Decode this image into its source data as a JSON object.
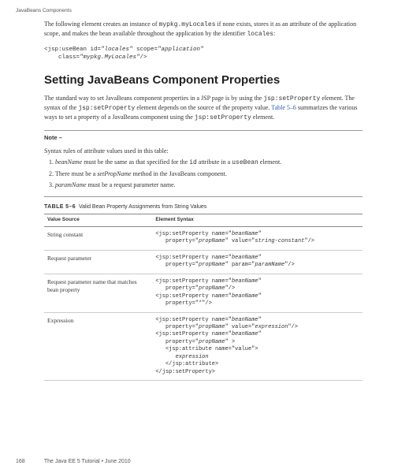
{
  "running_head": "JavaBeans Components",
  "intro_html": "The following element creates an instance of <span class=\"mono\">mypkg.myLocales</span> if none exists, stores it as an attribute of the application scope, and makes the bean available throughout the application by the identifier <span class=\"mono\">locales</span>:",
  "code_block": "<jsp:useBean id=<span class=\"it\">\"locales\"</span> scope=<span class=\"it\">\"application\"</span>\n    class=<span class=\"it\">\"mypkg.MyLocales\"</span>/>",
  "heading": "Setting JavaBeans Component Properties",
  "body_html": "The standard way to set JavaBeans component properties in a JSP page is by using the <span class=\"mono\">jsp:setProperty</span> element. The syntax of the <span class=\"mono\">jsp:setProperty</span> element depends on the source of the property value. <span class=\"link\">Table 5–6</span> summarizes the various ways to set a property of a JavaBeans component using the <span class=\"mono\">jsp:setProperty</span> element.",
  "note_label": "Note –",
  "syntax_rules_lead": "Syntax rules of attribute values used in this table:",
  "rules": [
    "<span class=\"italic\">beanName</span> must be the same as that specified for the <span class=\"mono\">id</span> attribute in a <span class=\"mono\">useBean</span> element.",
    "There must be a <span class=\"italic\">setPropName</span> method in the JavaBeans component.",
    "<span class=\"italic\">paramName</span> must be a request parameter name."
  ],
  "table": {
    "tag": "TABLE 5–6",
    "title": "Valid Bean Property Assignments from String Values",
    "headers": [
      "Value Source",
      "Element Syntax"
    ],
    "rows": [
      {
        "source": "String constant",
        "syntax": "<jsp:setProperty name=\"<span class=\"it\">beanName</span>\"\n   property=\"<span class=\"it\">propName</span>\" value=\"<span class=\"it\">string-constant</span>\"/>"
      },
      {
        "source": "Request parameter",
        "syntax": "<jsp:setProperty name=\"<span class=\"it\">beanName</span>\"\n   property=\"<span class=\"it\">propName</span>\" param=\"<span class=\"it\">paramName</span>\"/>"
      },
      {
        "source": "Request parameter name that matches bean property",
        "syntax": "<jsp:setProperty name=\"<span class=\"it\">beanName</span>\"\n   property=\"<span class=\"it\">propName</span>\"/>\n<jsp:setProperty name=\"<span class=\"it\">beanName</span>\"\n   property=\"*\"/>"
      },
      {
        "source": "Expression",
        "syntax": "<jsp:setProperty name=\"<span class=\"it\">beanName</span>\"\n   property=\"<span class=\"it\">propName</span>\" value=\"<span class=\"it\">expression</span>\"/>\n<jsp:setProperty name=\"<span class=\"it\">beanName</span>\"\n   property=\"<span class=\"it\">propName</span>\" >\n   <jsp:attribute name=\"value\">\n      <span class=\"it\">expression</span>\n   </jsp:attribute>\n</jsp:setProperty>"
      }
    ]
  },
  "footer": {
    "page": "168",
    "text": "The Java EE 5 Tutorial  •  June 2010"
  }
}
